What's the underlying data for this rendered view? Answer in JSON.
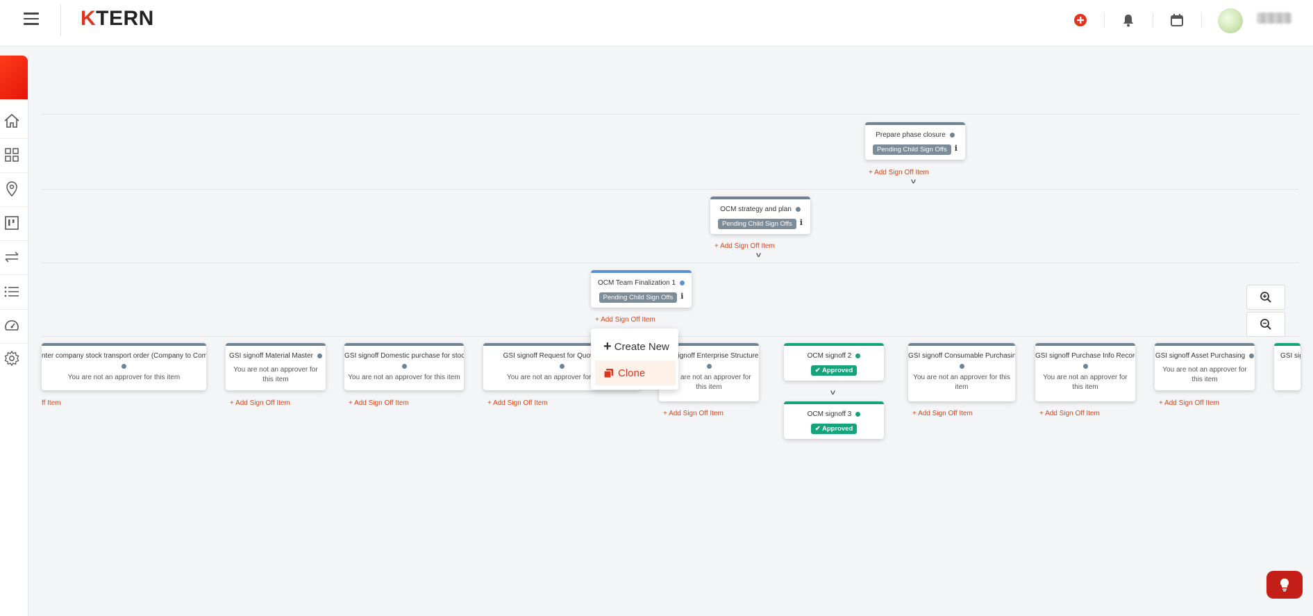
{
  "header": {
    "logo_k": "K",
    "logo_rest": "TERN",
    "icons": [
      "menu-icon",
      "add-circle-icon",
      "bell-icon",
      "calendar-icon",
      "avatar"
    ],
    "accent": "#e2341d"
  },
  "sidebar": {
    "items": [
      "home-icon",
      "grid-icon",
      "location-icon",
      "board-icon",
      "transfer-icon",
      "list-icon",
      "dashboard-icon",
      "settings-icon"
    ]
  },
  "tree": {
    "add_label": "Add Sign Off Item",
    "add_label_partial": "ff Item",
    "l1": {
      "title": "Prepare phase closure",
      "status": "Pending Child Sign Offs"
    },
    "l2": {
      "title": "OCM strategy and plan",
      "status": "Pending Child Sign Offs"
    },
    "l3": {
      "title": "OCM Team Finalization 1",
      "status": "Pending Child Sign Offs"
    },
    "not_approver": "You are not an approver for this item",
    "leaves": [
      {
        "title": "nter company stock transport order (Company to Company)"
      },
      {
        "title": "GSI signoff Material Master"
      },
      {
        "title": "GSI signoff Domestic purchase for stock"
      },
      {
        "title": "GSI signoff Request for Quotation & V"
      },
      {
        "title": "signoff Enterprise Structure"
      },
      {
        "title": "OCM signoff 2",
        "status": "Approved"
      },
      {
        "title": "OCM signoff 3",
        "status": "Approved"
      },
      {
        "title": "GSI signoff Consumable Purchasing"
      },
      {
        "title": "GSI signoff Purchase Info Record"
      },
      {
        "title": "GSI signoff Asset Purchasing"
      },
      {
        "title": "GSI sig"
      }
    ],
    "status_colors": {
      "pending": "#7d8c99",
      "approved": "#16a37a",
      "active": "#5b91d6"
    }
  },
  "context_menu": {
    "create_new": "Create New",
    "clone": "Clone"
  },
  "zoom": {
    "in_icon": "zoom-in-icon",
    "out_icon": "zoom-out-icon"
  },
  "help": {
    "icon": "lightbulb-icon"
  }
}
